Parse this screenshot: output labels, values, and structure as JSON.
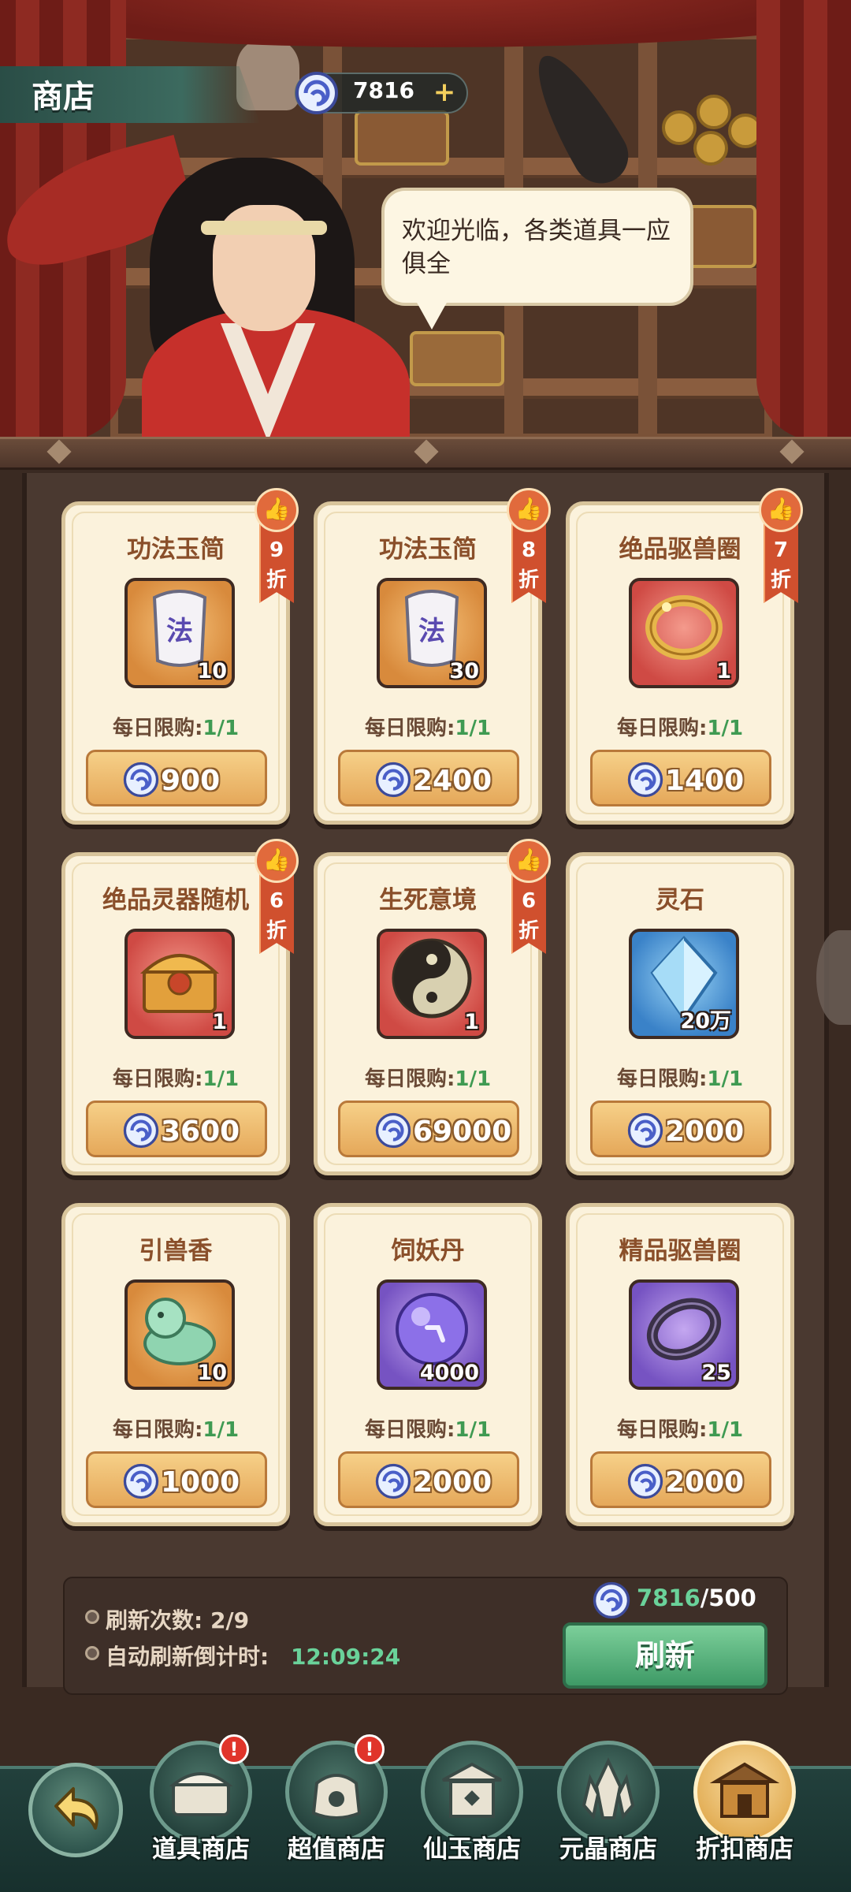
{
  "header": {
    "title": "商店",
    "currency_value": "7816",
    "plus_label": "+"
  },
  "npc": {
    "dialog": "欢迎光临，各类道具一应俱全"
  },
  "limit_prefix": "每日限购:",
  "items": [
    {
      "name": "功法玉简",
      "qty": "10",
      "limit": "1/1",
      "price": "900",
      "discount": "9",
      "discount_suffix": "折",
      "bg": "orange",
      "icon": "jade-slip-icon",
      "icon_char": "法"
    },
    {
      "name": "功法玉简",
      "qty": "30",
      "limit": "1/1",
      "price": "2400",
      "discount": "8",
      "discount_suffix": "折",
      "bg": "orange",
      "icon": "jade-slip-icon",
      "icon_char": "法"
    },
    {
      "name": "绝品驱兽圈",
      "qty": "1",
      "limit": "1/1",
      "price": "1400",
      "discount": "7",
      "discount_suffix": "折",
      "bg": "red",
      "icon": "golden-ring-icon"
    },
    {
      "name": "绝品灵器随机",
      "qty": "1",
      "limit": "1/1",
      "price": "3600",
      "discount": "6",
      "discount_suffix": "折",
      "bg": "red",
      "icon": "treasure-chest-icon"
    },
    {
      "name": "生死意境",
      "qty": "1",
      "limit": "1/1",
      "price": "69000",
      "discount": "6",
      "discount_suffix": "折",
      "bg": "red",
      "icon": "yin-yang-orb-icon"
    },
    {
      "name": "灵石",
      "qty": "20万",
      "limit": "1/1",
      "price": "2000",
      "bg": "blue",
      "icon": "spirit-stone-icon"
    },
    {
      "name": "引兽香",
      "qty": "10",
      "limit": "1/1",
      "price": "1000",
      "bg": "orange",
      "icon": "jade-beast-icon"
    },
    {
      "name": "饲妖丹",
      "qty": "4000",
      "limit": "1/1",
      "price": "2000",
      "bg": "purple",
      "icon": "purple-pill-icon"
    },
    {
      "name": "精品驱兽圈",
      "qty": "25",
      "limit": "1/1",
      "price": "2000",
      "bg": "purple",
      "icon": "dark-ring-icon"
    }
  ],
  "refresh": {
    "count_label": "刷新次数:",
    "count_value": "2/9",
    "timer_label": "自动刷新倒计时:",
    "timer_value": "12:09:24",
    "cost_current": "7816",
    "cost_required": "/500",
    "button_label": "刷新"
  },
  "nav": {
    "tabs": [
      {
        "label": "道具商店",
        "badge": "!"
      },
      {
        "label": "超值商店",
        "badge": "!"
      },
      {
        "label": "仙玉商店"
      },
      {
        "label": "元晶商店"
      },
      {
        "label": "折扣商店",
        "active": true
      }
    ]
  },
  "colors": {
    "accent_green": "#3f9a52",
    "discount_ribbon": "#d0502e",
    "card_bg": "#fbf2dc",
    "nav_bg": "#22403c"
  }
}
